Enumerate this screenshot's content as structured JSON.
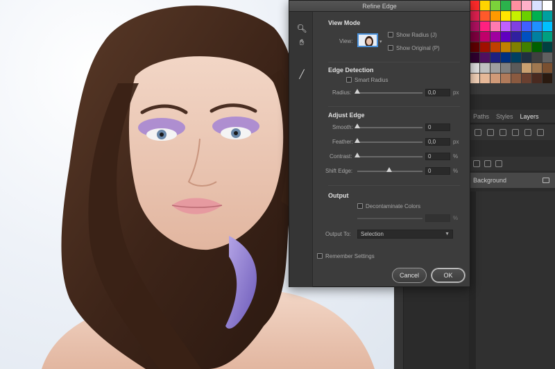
{
  "dialog": {
    "title": "Refine Edge",
    "view_mode": {
      "title": "View Mode",
      "view_label": "View:",
      "show_radius": "Show Radius (J)",
      "show_original": "Show Original (P)"
    },
    "edge_detection": {
      "title": "Edge Detection",
      "smart_radius": "Smart Radius",
      "radius_label": "Radius:",
      "radius_value": "0,0",
      "radius_unit": "px"
    },
    "adjust_edge": {
      "title": "Adjust Edge",
      "smooth_label": "Smooth:",
      "smooth_value": "0",
      "feather_label": "Feather:",
      "feather_value": "0,0",
      "feather_unit": "px",
      "contrast_label": "Contrast:",
      "contrast_value": "0",
      "contrast_unit": "%",
      "shift_label": "Shift Edge:",
      "shift_value": "0",
      "shift_unit": "%"
    },
    "output": {
      "title": "Output",
      "decontaminate": "Decontaminate Colors",
      "amount_unit": "%",
      "output_to_label": "Output To:",
      "output_to_value": "Selection"
    },
    "remember": "Remember Settings",
    "cancel": "Cancel",
    "ok": "OK"
  },
  "panels": {
    "tabs": [
      "Paths",
      "Styles",
      "Layers"
    ],
    "active_tab": "Layers",
    "layer_name": "Background"
  },
  "swatch_colors": [
    "#ff2a2a",
    "#ffd400",
    "#7bd23a",
    "#2bb24c",
    "#ff8fa0",
    "#ffb0c8",
    "#d8e0ff",
    "#ffffff",
    "#e02050",
    "#ff5a2a",
    "#ff9a00",
    "#ffe600",
    "#c6f000",
    "#6ad000",
    "#00b050",
    "#00a0a0",
    "#b01060",
    "#ff2080",
    "#ff7ab0",
    "#c060ff",
    "#8040e0",
    "#4060ff",
    "#2090ff",
    "#00c0ff",
    "#800040",
    "#c0006a",
    "#a000a0",
    "#6000c0",
    "#3020a0",
    "#0050c0",
    "#0080a0",
    "#00a080",
    "#600000",
    "#a01000",
    "#c04000",
    "#c08000",
    "#808000",
    "#408000",
    "#006000",
    "#004040",
    "#300030",
    "#501060",
    "#202080",
    "#003080",
    "#004060",
    "#203040",
    "#404040",
    "#606060",
    "#e0e0e0",
    "#c0c0c0",
    "#a0a0a0",
    "#808080",
    "#5a5a5a",
    "#c9a070",
    "#a07850",
    "#7a5030",
    "#f4d2b8",
    "#e6b898",
    "#d09a78",
    "#b07a5a",
    "#8a5a40",
    "#6a4030",
    "#4a2a20",
    "#2a1a10"
  ]
}
